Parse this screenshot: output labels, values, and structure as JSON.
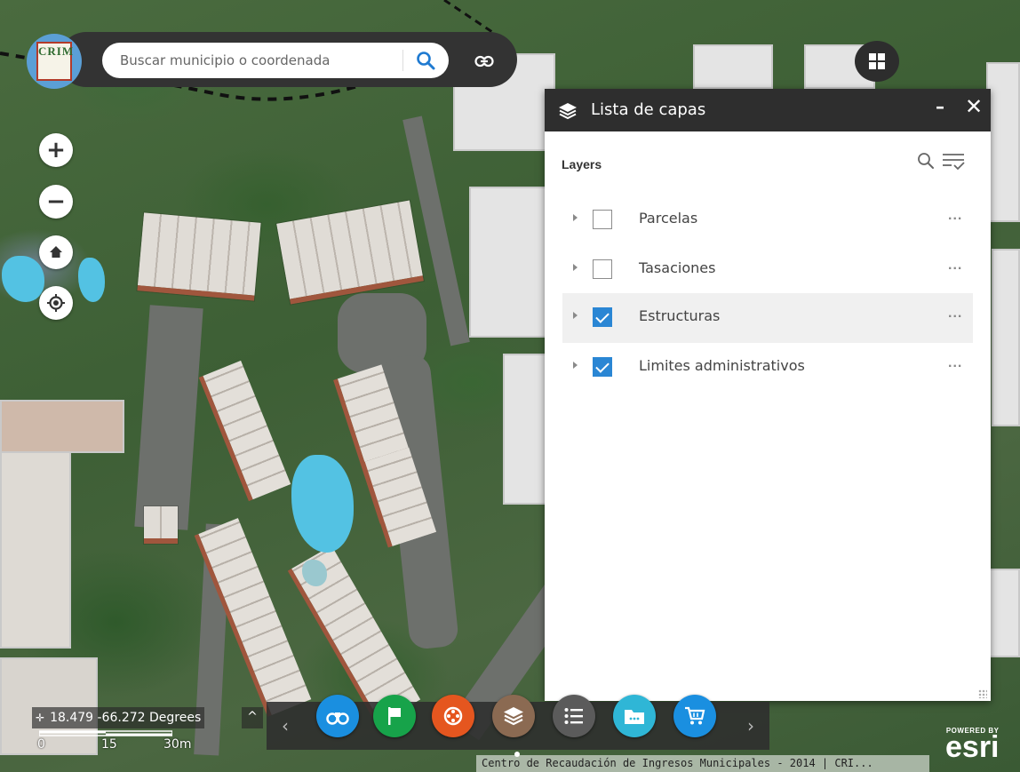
{
  "app": {
    "logo_text": "CRIM",
    "search": {
      "placeholder": "Buscar municipio o coordenada"
    }
  },
  "map_controls": {
    "zoom_in": "+",
    "zoom_out": "−"
  },
  "layer_panel": {
    "title": "Lista de capas",
    "minimize": "–",
    "close": "✕",
    "section_label": "Layers",
    "layers": [
      {
        "name": "Parcelas",
        "checked": false,
        "menu": "..."
      },
      {
        "name": "Tasaciones",
        "checked": false,
        "menu": "..."
      },
      {
        "name": "Estructuras",
        "checked": true,
        "menu": "..."
      },
      {
        "name": "Limites administrativos",
        "checked": true,
        "menu": "..."
      }
    ]
  },
  "toolbar": {
    "prev": "‹",
    "next": "›",
    "buttons": [
      {
        "icon": "binoculars-icon",
        "color": "#1a8fe0"
      },
      {
        "icon": "flag-icon",
        "color": "#17a34a"
      },
      {
        "icon": "film-reel-icon",
        "color": "#e5561f"
      },
      {
        "icon": "layers-icon",
        "color": "#8b6a52"
      },
      {
        "icon": "list-icon",
        "color": "#5b5b5b"
      },
      {
        "icon": "folder-icon",
        "color": "#2fb6d6"
      },
      {
        "icon": "cart-icon",
        "color": "#1a8fe0"
      }
    ]
  },
  "status": {
    "coordinates": "18.479 -66.272 Degrees",
    "coords_toggle": "^",
    "scale": [
      "0",
      "15",
      "30m"
    ]
  },
  "attribution": "Centro de Recaudación de Ingresos Municipales - 2014 | CRI...",
  "esri": {
    "small": "POWERED BY",
    "big": "esri"
  }
}
